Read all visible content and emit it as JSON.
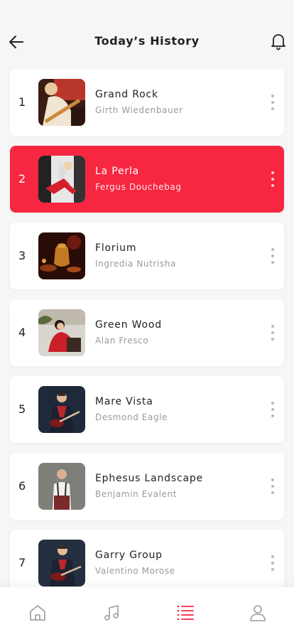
{
  "header": {
    "title": "Today’s History",
    "back_icon": "arrow-left-icon",
    "notify_icon": "bell-icon"
  },
  "colors": {
    "accent": "#f72641",
    "background": "#f6f6f6",
    "card": "#ffffff",
    "text": "#222222",
    "muted": "#9a9a9a"
  },
  "history": {
    "items": [
      {
        "rank": "1",
        "title": "Grand Rock",
        "artist": "Girth Wiedenbauer",
        "active": false
      },
      {
        "rank": "2",
        "title": "La Perla",
        "artist": "Fergus Douchebag",
        "active": true
      },
      {
        "rank": "3",
        "title": "Florium",
        "artist": "Ingredia Nutrisha",
        "active": false
      },
      {
        "rank": "4",
        "title": "Green Wood",
        "artist": "Alan Fresco",
        "active": false
      },
      {
        "rank": "5",
        "title": "Mare Vista",
        "artist": "Desmond Eagle",
        "active": false
      },
      {
        "rank": "6",
        "title": "Ephesus Landscape",
        "artist": "Benjamin Evalent",
        "active": false
      },
      {
        "rank": "7",
        "title": "Garry Group",
        "artist": "Valentino Morose",
        "active": false
      }
    ]
  },
  "nav": {
    "items": [
      {
        "icon": "home-icon",
        "active": false
      },
      {
        "icon": "music-note-icon",
        "active": false
      },
      {
        "icon": "list-icon",
        "active": true
      },
      {
        "icon": "user-icon",
        "active": false
      }
    ]
  }
}
